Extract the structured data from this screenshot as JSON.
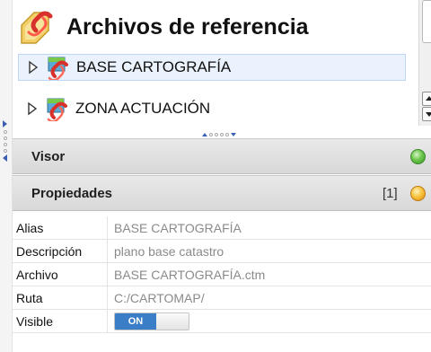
{
  "tree": {
    "title": "Archivos de referencia",
    "items": [
      {
        "label": "BASE CARTOGRAFÍA",
        "selected": true
      },
      {
        "label": "ZONA ACTUACIÓN",
        "selected": false
      }
    ]
  },
  "sections": {
    "visor": {
      "title": "Visor",
      "status": "green"
    },
    "propiedades": {
      "title": "Propiedades",
      "count": "[1]",
      "status": "orange"
    }
  },
  "properties": [
    {
      "label": "Alias",
      "value": "BASE CARTOGRAFÍA"
    },
    {
      "label": "Descripción",
      "value": "plano base catastro"
    },
    {
      "label": "Archivo",
      "value": "BASE CARTOGRAFÍA.ctm"
    },
    {
      "label": "Ruta",
      "value": "C:/CARTOMAP/"
    },
    {
      "label": "Visible",
      "toggle": "ON"
    }
  ],
  "colors": {
    "accent": "#3a7ec8",
    "status_green": "#6cc54b",
    "status_orange": "#f7c43f",
    "selection": "#eaf3fd"
  },
  "icons": {
    "header": "folder-link-icon",
    "layer": "layer-link-icon"
  }
}
